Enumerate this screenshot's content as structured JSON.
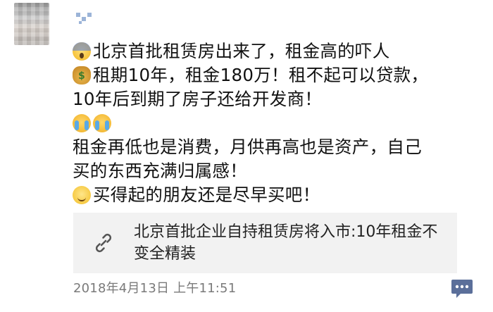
{
  "post": {
    "line1": "北京首批租赁房出来了，租金高的吓人",
    "line2": "租期10年，租金180万！租不起可以贷款，",
    "line3": "10年后到期了房子还给开发商！",
    "line4": "租金再低也是消费，月供再高也是资产，自己",
    "line5": "买的东西充满归属感！",
    "line6": "买得起的朋友还是尽早买吧！"
  },
  "emojis": {
    "line1": "face-screaming-in-fear",
    "line2": "money-bag",
    "row_cry": [
      "loudly-crying-face",
      "loudly-crying-face"
    ],
    "line6": "smiling-face"
  },
  "link_card": {
    "title": "北京首批企业自持租赁房将入市:10年租金不变全精装",
    "icon": "link-icon"
  },
  "timestamp": "2018年4月13日 上午11:51",
  "comment_button": {
    "icon": "comment-icon"
  },
  "colors": {
    "text": "#111111",
    "link_card_bg": "#f2f2f2",
    "timestamp": "#7a7a7a",
    "accent_blue": "#4a77b8"
  }
}
